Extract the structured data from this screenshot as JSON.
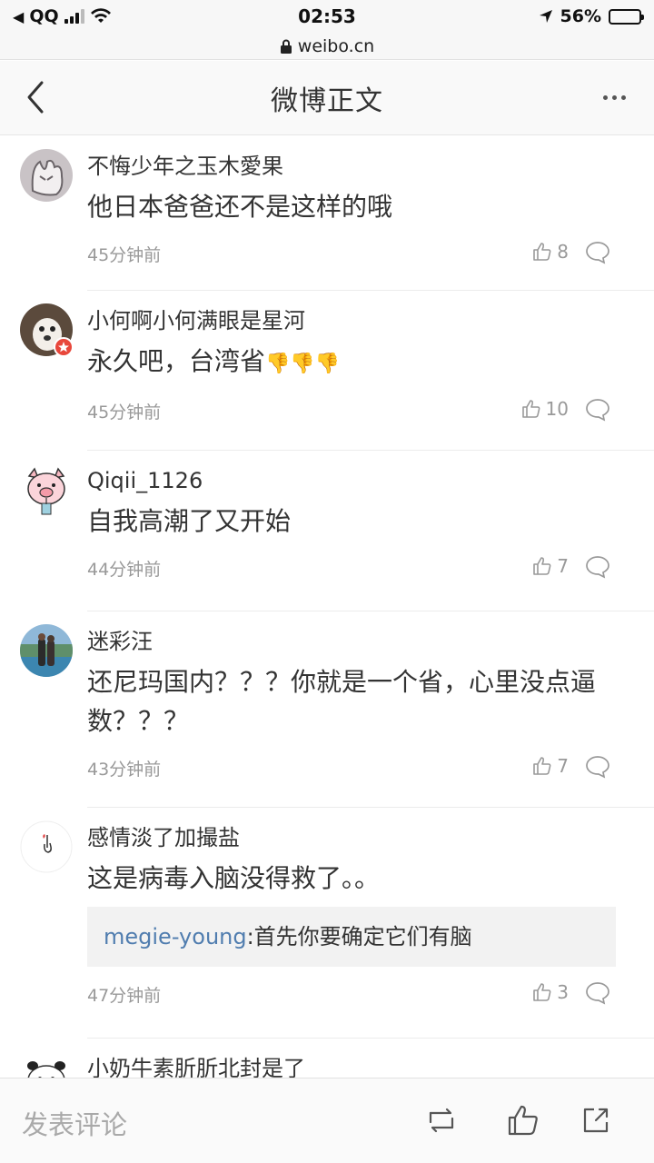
{
  "statusbar": {
    "carrier": "QQ",
    "time": "02:53",
    "battery": "56%",
    "battery_level": 0.56
  },
  "urlbar": {
    "domain": "weibo.cn"
  },
  "nav": {
    "title": "微博正文",
    "back_icon": "chevron-left-icon",
    "more_icon": "more-dots-icon"
  },
  "comments": [
    {
      "author": "不悔少年之玉木愛果",
      "text": "他日本爸爸还不是这样的哦",
      "time": "45分钟前",
      "likes": "8"
    },
    {
      "author": "小何啊小何满眼是星河",
      "text": "永久吧，台湾省",
      "emoji": "👎👎👎",
      "time": "45分钟前",
      "likes": "10"
    },
    {
      "author": "Qiqii_1126",
      "text": "自我高潮了又开始",
      "time": "44分钟前",
      "likes": "7"
    },
    {
      "author": "迷彩汪",
      "text": "还尼玛国内？？？你就是一个省，心里没点逼数？？？",
      "time": "43分钟前",
      "likes": "7"
    },
    {
      "author": "感情淡了加撮盐",
      "text": "这是病毒入脑没得救了。。",
      "time": "47分钟前",
      "likes": "3",
      "reply": {
        "name": "megie-young",
        "text": ":首先你要确定它们有脑"
      }
    },
    {
      "author": "小奶牛素肵肵北封是了"
    }
  ],
  "bottombar": {
    "compose_label": "发表评论"
  },
  "colors": {
    "accent_link": "#507daf",
    "muted": "#999999"
  }
}
